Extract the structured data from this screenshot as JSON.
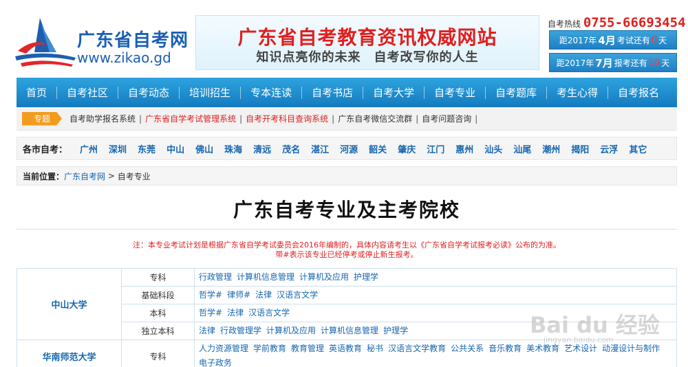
{
  "header": {
    "logo_zh": "广东省自考网",
    "logo_en": "www.zikao.gd",
    "banner_title": "广东省自考教育资讯权威网站",
    "banner_subtitle": "知识点亮你的未来　自考改写你的人生",
    "hotline_label": "自考热线",
    "hotline_number": "0755-66693454",
    "countdown_exam": {
      "prefix": "距2017年",
      "month": "4月",
      "middle": "考试还有",
      "days": "0",
      "suffix": "天"
    },
    "countdown_register": {
      "prefix": "距2017年",
      "month": "7月",
      "middle": "报考还有",
      "days": "10",
      "suffix": "天"
    }
  },
  "nav": [
    "首页",
    "自考社区",
    "自考动态",
    "培训招生",
    "专本连读",
    "自考书店",
    "自考大学",
    "自考专业",
    "自考题库",
    "考生心得",
    "自考报名"
  ],
  "special": {
    "tag": "专题",
    "links": [
      "自考助学报名系统",
      "广东省自学考试管理系统",
      "自考开考科目查询系统",
      "广东自考微信交流群",
      "自考问题咨询"
    ],
    "link_colors": [
      "#333333",
      "#e01f1f",
      "#e01f1f",
      "#333333",
      "#333333"
    ]
  },
  "cities": {
    "label": "各市自考：",
    "items": [
      "广州",
      "深圳",
      "东莞",
      "中山",
      "佛山",
      "珠海",
      "清远",
      "茂名",
      "湛江",
      "河源",
      "韶关",
      "肇庆",
      "江门",
      "惠州",
      "汕头",
      "汕尾",
      "潮州",
      "揭阳",
      "云浮",
      "其它"
    ]
  },
  "breadcrumb": {
    "label": "当前位置：",
    "home": "广东自考网",
    "sep": " > ",
    "current": "自考专业"
  },
  "page_title": "广东自考专业及主考院校",
  "notes": {
    "line1": "注：本专业考试计划是根据广东省自学考试委员会2016年编制的，具体内容请考生以《广东省自学考试报考必读》公布的为准。",
    "line2": "带#表示该专业已经停考或停止新生报考。"
  },
  "schools": [
    {
      "name": "中山大学",
      "rows": [
        {
          "level": "专科",
          "majors": [
            "行政管理",
            "计算机信息管理",
            "计算机及应用",
            "护理学"
          ]
        },
        {
          "level": "基础科段",
          "majors": [
            "哲学#",
            "律师#",
            "法律",
            "汉语言文学"
          ]
        },
        {
          "level": "本科",
          "majors": [
            "哲学#",
            "法律",
            "汉语言文学"
          ]
        },
        {
          "level": "独立本科",
          "majors": [
            "法律",
            "行政管理学",
            "计算机及应用",
            "计算机信息管理",
            "护理学"
          ]
        }
      ]
    },
    {
      "name": "华南师范大学",
      "rows": [
        {
          "level": "专科",
          "majors": [
            "人力资源管理",
            "学前教育",
            "教育管理",
            "英语教育",
            "秘书",
            "汉语言文学教育",
            "公共关系",
            "音乐教育",
            "美术教育",
            "艺术设计",
            "动漫设计与制作",
            "电子政务"
          ]
        }
      ]
    }
  ],
  "watermark": {
    "main": "Bai du 经验",
    "sub": "jingyan.baidu.com"
  },
  "colors": {
    "nav_blue": "#1f8fd3",
    "link_blue": "#1666b0",
    "alert_red": "#e01f1f",
    "tag_orange": "#f29c1f"
  }
}
